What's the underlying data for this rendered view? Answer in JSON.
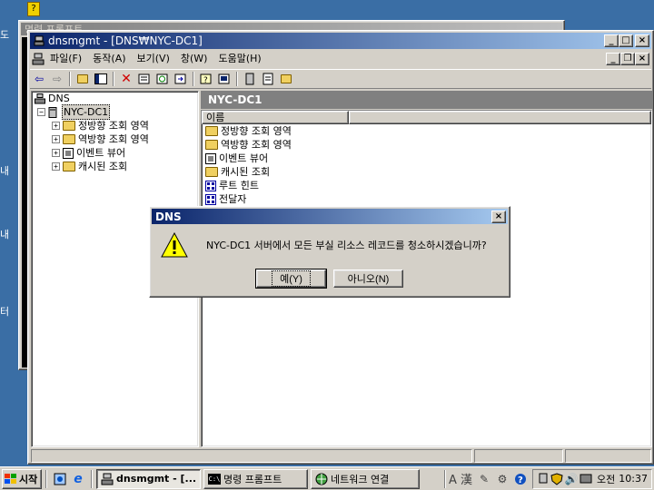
{
  "background_window": {
    "title": "명령 프롬프트"
  },
  "main_window": {
    "title": "dnsmgmt - [DNS₩NYC-DC1]",
    "menu": [
      "파일(F)",
      "동작(A)",
      "보기(V)",
      "창(W)",
      "도움말(H)"
    ],
    "tree": {
      "root": "DNS",
      "server": "NYC-DC1",
      "children": [
        "정방향 조회 영역",
        "역방향 조회 영역",
        "이벤트 뷰어",
        "캐시된 조회"
      ]
    },
    "right_pane": {
      "header": "NYC-DC1",
      "column_name": "이름",
      "items": [
        "정방향 조회 영역",
        "역방향 조회 영역",
        "이벤트 뷰어",
        "캐시된 조회",
        "루트 힌트",
        "전달자"
      ]
    }
  },
  "dialog": {
    "title": "DNS",
    "message": "NYC-DC1 서버에서 모든 부실 리소스 레코드를 청소하시겠습니까?",
    "yes_label": "예(Y)",
    "no_label": "아니오(N)"
  },
  "taskbar": {
    "start_label": "시작",
    "tasks": [
      "dnsmgmt - [...",
      "명령 프롬프트",
      "네트워크 연결"
    ],
    "ime_label": "A 漢",
    "lang_label": "오전",
    "clock": "10:37"
  },
  "desktop": {
    "side_labels": [
      "도",
      "내",
      "내",
      "터"
    ]
  }
}
